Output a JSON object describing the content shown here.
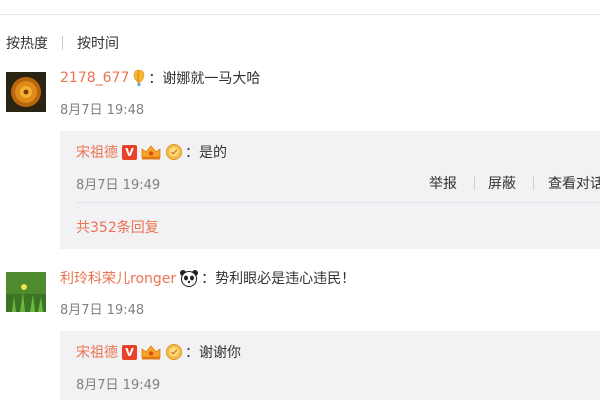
{
  "sort_bar": {
    "hot_label": "按热度",
    "time_label": "按时间"
  },
  "comments": [
    {
      "username": "2178_677",
      "colon": "：",
      "text": "谢娜就一马大哈",
      "time": "8月7日 19:48",
      "reply": {
        "username": "宋祖德",
        "colon": "：",
        "text": "是的",
        "time": "8月7日 19:49",
        "actions": [
          "举报",
          "屏蔽",
          "查看对话"
        ],
        "reply_count_label": "共352条回复"
      }
    },
    {
      "username": "利玲科荣儿ronger",
      "colon": "：",
      "text": "势利眼必是违心违民！",
      "time": "8月7日 19:48",
      "reply": {
        "username": "宋祖德",
        "colon": "：",
        "text": "谢谢你",
        "time": "8月7日 19:49"
      }
    }
  ],
  "badges": {
    "verified_letter": "V"
  },
  "colors": {
    "username": "#eb7350",
    "verified": "#e8402b",
    "reply_bg": "#f2f2f5",
    "timestamp": "#808080"
  },
  "icons": [
    "balloon-icon",
    "verified-v-icon",
    "vip-crown-icon",
    "medal-icon",
    "panda-icon"
  ]
}
